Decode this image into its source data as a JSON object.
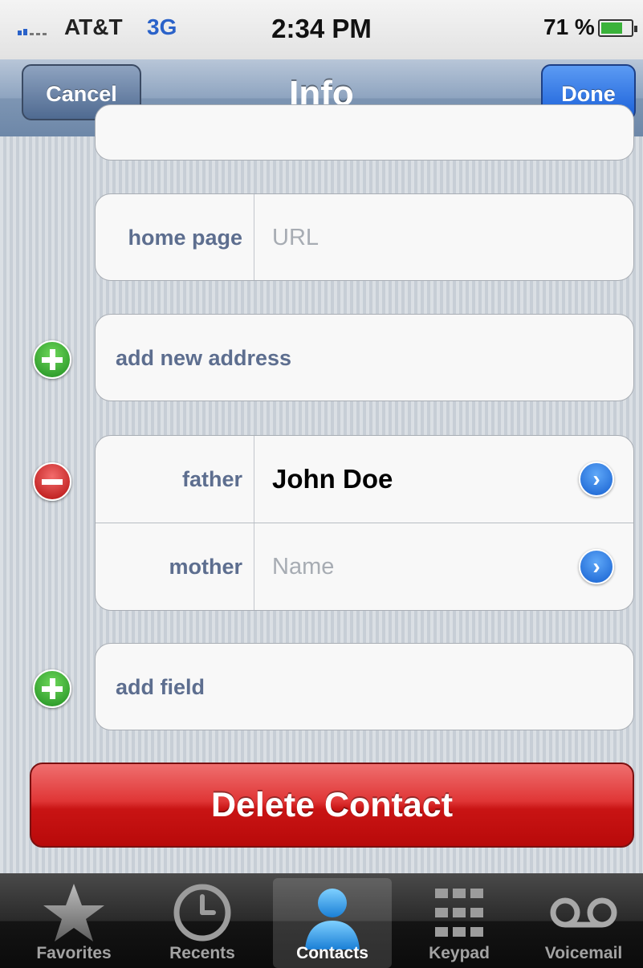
{
  "status_bar": {
    "carrier": "AT&T",
    "network": "3G",
    "time": "2:34 PM",
    "battery": "71 %",
    "battery_level": 0.71
  },
  "nav": {
    "title": "Info",
    "cancel_label": "Cancel",
    "done_label": "Done"
  },
  "home_page": {
    "label": "home page",
    "placeholder": "URL"
  },
  "add_address": {
    "label": "add new address"
  },
  "relations": [
    {
      "label": "father",
      "value": "John Doe"
    },
    {
      "label": "mother",
      "placeholder": "Name"
    }
  ],
  "add_field": {
    "label": "add field"
  },
  "delete_label": "Delete Contact",
  "tabs": [
    {
      "label": "Favorites",
      "icon": "star-icon"
    },
    {
      "label": "Recents",
      "icon": "clock-icon"
    },
    {
      "label": "Contacts",
      "icon": "person-icon",
      "active": true
    },
    {
      "label": "Keypad",
      "icon": "keypad-icon"
    },
    {
      "label": "Voicemail",
      "icon": "voicemail-icon"
    }
  ],
  "colors": {
    "label_blue": "#5d6e8f",
    "done_blue": "#1a5fd9",
    "delete_red": "#c91414",
    "plus_green": "#1f8d20"
  }
}
